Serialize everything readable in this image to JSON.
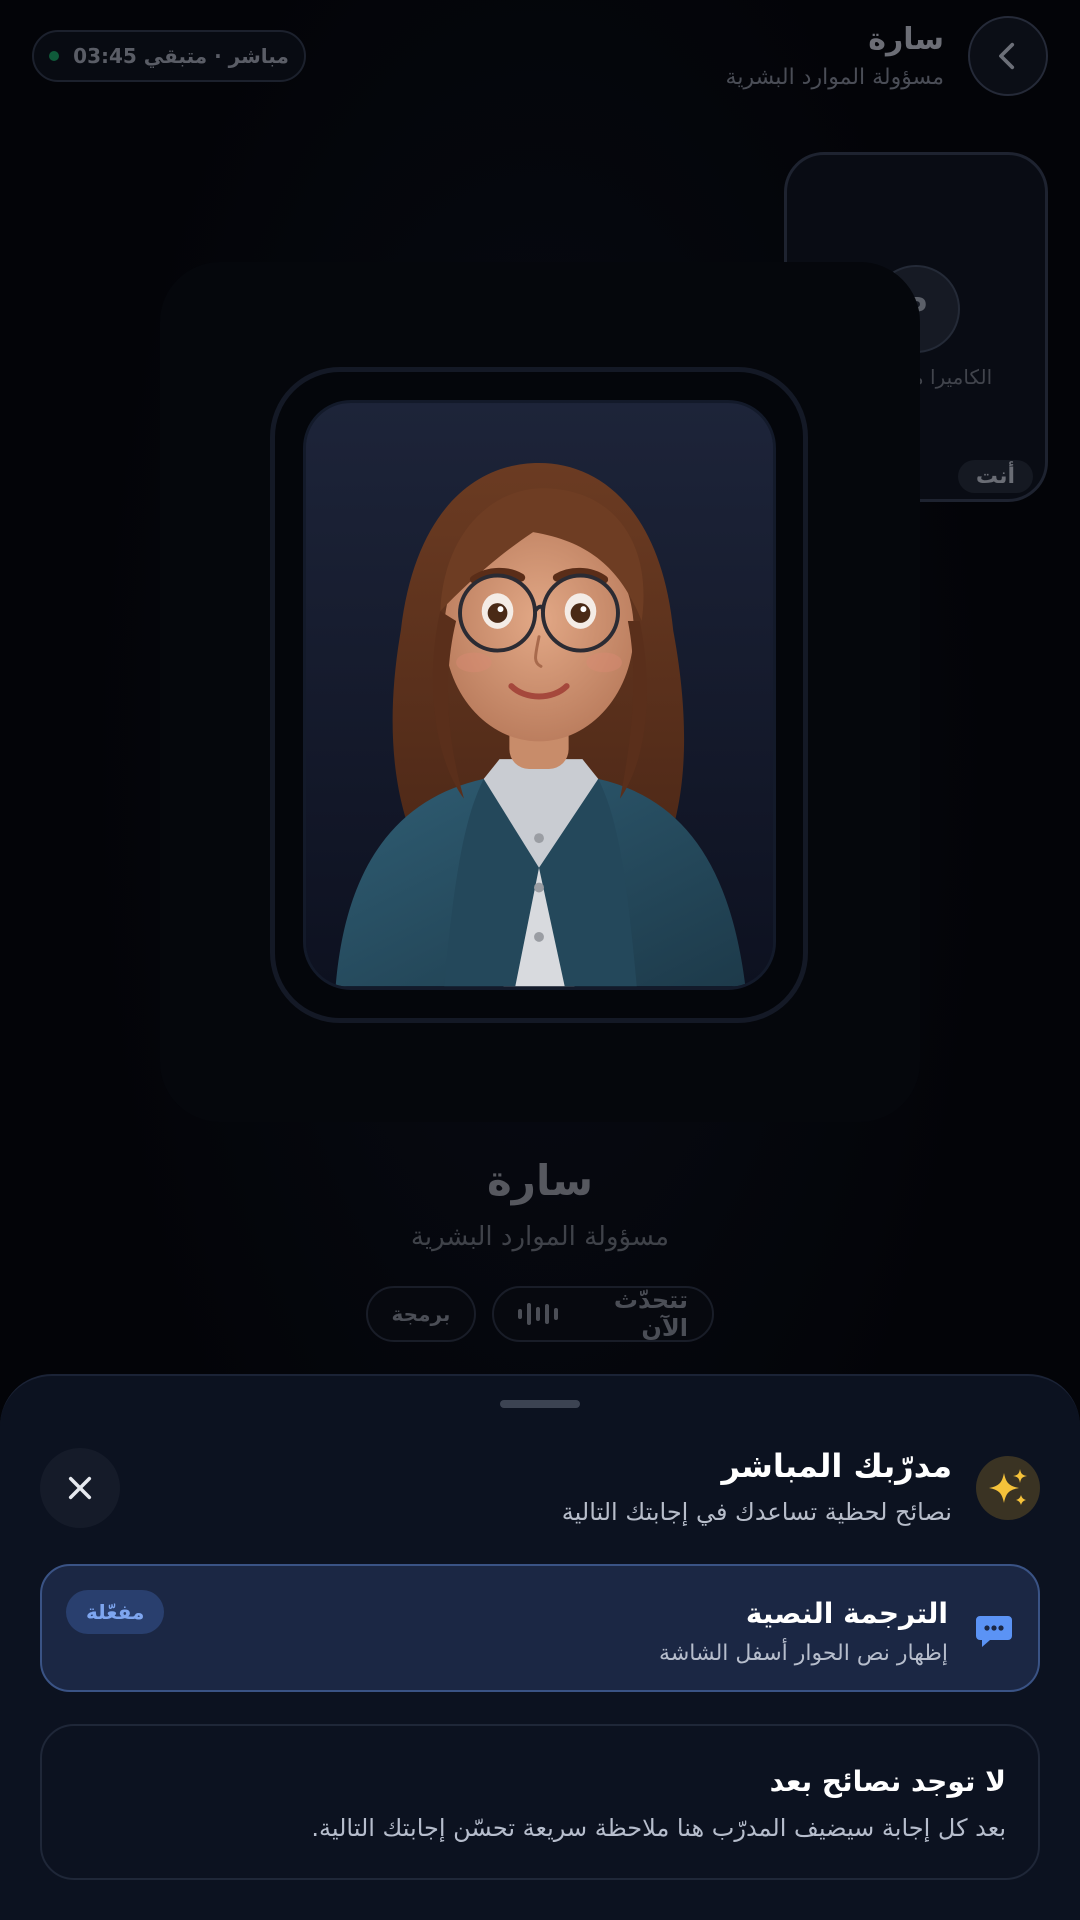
{
  "header": {
    "name": "سارة",
    "role": "مسؤولة الموارد البشرية",
    "live_status": "مباشر · متبقي 03:45"
  },
  "self_view": {
    "avatar_initial": "P",
    "camera_status": "الكاميرا مغلقة",
    "you_label": "أنت"
  },
  "speaker": {
    "name": "سارة",
    "role": "مسؤولة الموارد البشرية",
    "speaking_label": "تتحدّث الآن",
    "tag_label": "برمجة"
  },
  "coach": {
    "title": "مدرّبك المباشر",
    "subtitle": "نصائح لحظية تساعدك في إجابتك التالية",
    "captions": {
      "title": "الترجمة النصية",
      "subtitle": "إظهار نص الحوار أسفل الشاشة",
      "badge": "مفعّلة"
    },
    "tips": {
      "title": "لا توجد نصائح بعد",
      "body": "بعد كل إجابة سيضيف المدرّب هنا ملاحظة سريعة تحسّن إجابتك التالية."
    }
  },
  "colors": {
    "accent": "#7ea6f0",
    "live_dot": "#0f5a3a",
    "sheet_bg": "#0c1220",
    "caption_card_bg": "#1b2744"
  },
  "icons": {
    "back": "chevron-left-icon",
    "camera_off": "video-off-icon",
    "sparkle": "sparkles-icon",
    "close": "close-icon",
    "chat": "chat-bubble-icon",
    "waveform": "waveform-icon"
  }
}
